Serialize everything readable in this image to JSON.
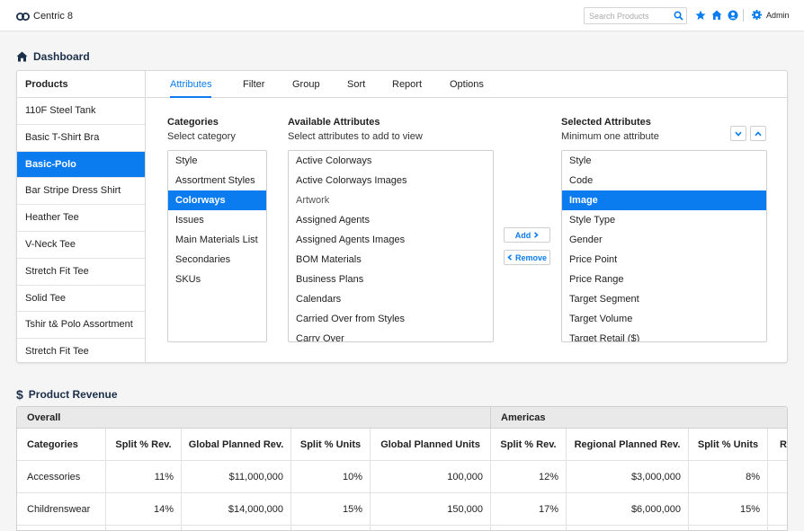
{
  "app": {
    "name": "Centric 8"
  },
  "topbar": {
    "search_placeholder": "Search Products",
    "user_label": "Admin"
  },
  "dashboard": {
    "title": "Dashboard"
  },
  "products": {
    "header": "Products",
    "items": [
      "110F Steel Tank",
      "Basic T-Shirt Bra",
      "Basic-Polo",
      "Bar Stripe Dress Shirt",
      "Heather Tee",
      "V-Neck Tee",
      "Stretch Fit Tee",
      "Solid Tee",
      "Tshir t& Polo Assortment",
      "Stretch Fit Tee"
    ],
    "selected_index": 2
  },
  "tabs": [
    "Attributes",
    "Filter",
    "Group",
    "Sort",
    "Report",
    "Options"
  ],
  "active_tab": "Attributes",
  "categories": {
    "title": "Categories",
    "subtitle": "Select category",
    "items": [
      "Style",
      "Assortment Styles",
      "Colorways",
      "Issues",
      "Main Materials List",
      "Secondaries",
      "SKUs"
    ],
    "selected_index": 2
  },
  "available": {
    "title": "Available Attributes",
    "subtitle": "Select attributes to add to view",
    "items": [
      "Active Colorways",
      "Active Colorways Images",
      "Artwork",
      "Assigned Agents",
      "Assigned Agents Images",
      "BOM Materials",
      "Business Plans",
      "Calendars",
      "Carried Over from Styles",
      "Carry Over"
    ]
  },
  "selected": {
    "title": "Selected Attributes",
    "subtitle": "Minimum one attribute",
    "items": [
      "Style",
      "Code",
      "Image",
      "Style Type",
      "Gender",
      "Price Point",
      "Price Range",
      "Target Segment",
      "Target Volume",
      "Target Retail ($)"
    ],
    "selected_index": 2
  },
  "buttons": {
    "add": "Add",
    "remove": "Remove"
  },
  "revenue": {
    "title": "Product Revenue",
    "groups": [
      "Overall",
      "Americas"
    ],
    "columns": [
      "Categories",
      "Split % Rev.",
      "Global Planned Rev.",
      "Split % Units",
      "Global Planned Units",
      "Split % Rev.",
      "Regional Planned Rev.",
      "Split % Units",
      "Re"
    ],
    "rows": [
      [
        "Accessories",
        "11%",
        "$11,000,000",
        "10%",
        "100,000",
        "12%",
        "$3,000,000",
        "8%",
        ""
      ],
      [
        "Childrenswear",
        "14%",
        "$14,000,000",
        "15%",
        "150,000",
        "17%",
        "$6,000,000",
        "15%",
        ""
      ]
    ]
  },
  "colors": {
    "accent": "#0a7cf0",
    "heading": "#1b2f4a",
    "brand": "#1b2f4a"
  }
}
